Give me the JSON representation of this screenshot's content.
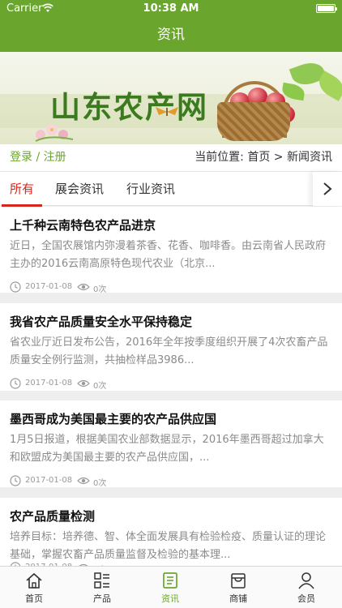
{
  "status": {
    "carrier": "Carrier",
    "time": "10:38 AM"
  },
  "nav": {
    "title": "资讯"
  },
  "banner": {
    "title": "山东农产网"
  },
  "topbar": {
    "login": "登录 / 注册",
    "breadcrumb": "当前位置:  首页 > 新闻资讯"
  },
  "tabs": [
    "所有",
    "展会资讯",
    "行业资讯"
  ],
  "news": [
    {
      "title": "上千种云南特色农产品进京",
      "summary": "近日，全国农展馆内弥漫着茶香、花香、咖啡香。由云南省人民政府主办的2016云南高原特色现代农业（北京...",
      "date": "2017-01-08",
      "views": "0次"
    },
    {
      "title": "我省农产品质量安全水平保持稳定",
      "summary": "省农业厅近日发布公告，2016年全年按季度组织开展了4次农畜产品质量安全例行监测，共抽检样品3986...",
      "date": "2017-01-08",
      "views": "0次"
    },
    {
      "title": "墨西哥成为美国最主要的农产品供应国",
      "summary": "1月5日报道，根据美国农业部数据显示，2016年墨西哥超过加拿大和欧盟成为美国最主要的农产品供应国，...",
      "date": "2017-01-08",
      "views": "0次"
    },
    {
      "title": "农产品质量检测",
      "summary": "培养目标：培养德、智、体全面发展具有检验检疫、质量认证的理论基础，掌握农畜产品质量监督及检验的基本理...",
      "date": "2017-01-08",
      "views": "0次"
    }
  ],
  "tabbar": [
    "首页",
    "产品",
    "资讯",
    "商铺",
    "会员"
  ],
  "colors": {
    "brand_green": "#6aa62d",
    "tab_active_red": "#d9261c"
  }
}
